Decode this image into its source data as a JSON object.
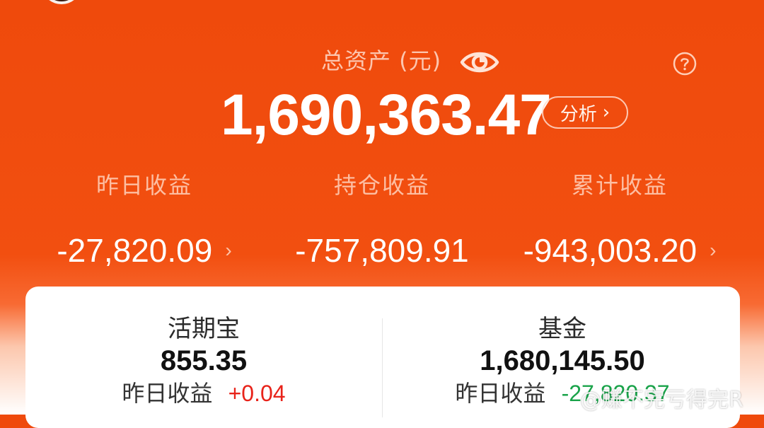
{
  "header": {
    "total_label": "总资产 (元)",
    "eye_icon": "eye-icon",
    "help_icon": "question-circle-icon",
    "total_value": "1,690,363.47",
    "analyze_label": "分析",
    "analyze_chevron": "›"
  },
  "stats": [
    {
      "label": "昨日收益",
      "value": "-27,820.09",
      "arrow": "›"
    },
    {
      "label": "持仓收益",
      "value": "-757,809.91",
      "arrow": ""
    },
    {
      "label": "累计收益",
      "value": "-943,003.20",
      "arrow": "›"
    }
  ],
  "assets": [
    {
      "name": "活期宝",
      "amount": "855.35",
      "yesterday_label": "昨日收益",
      "yesterday_value": "+0.04"
    },
    {
      "name": "基金",
      "amount": "1,680,145.50",
      "yesterday_label": "昨日收益",
      "yesterday_value": "-27,820.37"
    }
  ],
  "watermark": "@赚不完亏得完R",
  "colors": {
    "brand_orange": "#ef4a0c",
    "gain_positive": "#e8231a",
    "gain_negative": "#1aa34a"
  }
}
